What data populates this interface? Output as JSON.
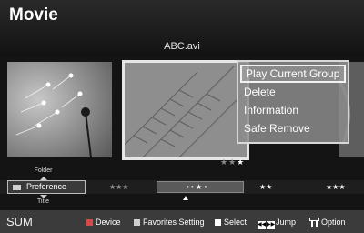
{
  "app": {
    "title": "Movie"
  },
  "current_file": "ABC.avi",
  "context_menu": {
    "items": [
      {
        "label": "Play Current Group",
        "selected": true
      },
      {
        "label": "Delete"
      },
      {
        "label": "Information"
      },
      {
        "label": "Safe Remove"
      }
    ]
  },
  "rating_stars": {
    "glyph_dim": "★★",
    "glyph_lit": "★"
  },
  "sort": {
    "prev_label": "Folder",
    "current_label": "Preference",
    "next_label": "Title"
  },
  "scroll_segments": [
    {
      "text": "★★★",
      "lit": false
    },
    {
      "text": "• • ★ •",
      "lit": true
    },
    {
      "text": "★★",
      "lit": false
    },
    {
      "text": "★★★",
      "lit": true
    }
  ],
  "footer": {
    "brand": "SUM",
    "device_label": "Device",
    "favorites_label": "Favorites Setting",
    "select_label": "Select",
    "jump_label": "Jump",
    "option_label": "Option"
  },
  "colors": {
    "device_key": "#d64a4a",
    "favorites_key": "#cfcfcf",
    "select_key": "#ffffff"
  }
}
